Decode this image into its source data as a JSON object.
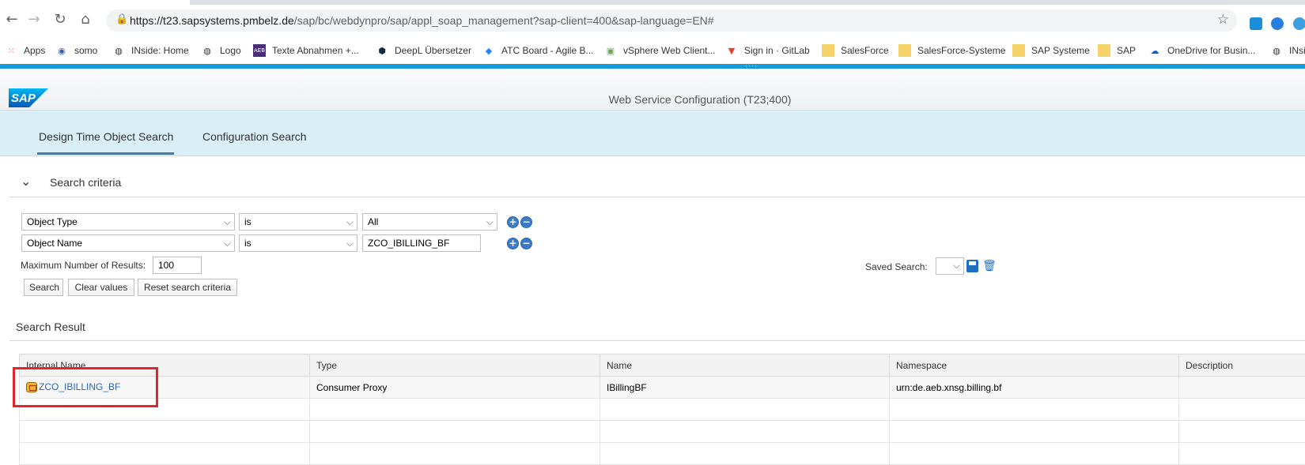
{
  "browser": {
    "url_host": "https://t23.sapsystems.pmbelz.de",
    "url_path": "/sap/bc/webdynpro/sap/appl_soap_management?sap-client=400&sap-language=EN#",
    "bookmarks": [
      {
        "label": "Apps",
        "icon": "apps-grid-icon"
      },
      {
        "label": "somo",
        "icon": "somo-icon"
      },
      {
        "label": "INside: Home",
        "icon": "globe-icon"
      },
      {
        "label": "Logo",
        "icon": "globe-icon"
      },
      {
        "label": "Texte Abnahmen +...",
        "icon": "aeb-icon"
      },
      {
        "label": "DeepL Übersetzer",
        "icon": "deepl-icon"
      },
      {
        "label": "ATC Board - Agile B...",
        "icon": "diamond-icon"
      },
      {
        "label": "vSphere Web Client...",
        "icon": "vsphere-icon"
      },
      {
        "label": "Sign in · GitLab",
        "icon": "gitlab-icon"
      },
      {
        "label": "SalesForce",
        "icon": "folder-icon"
      },
      {
        "label": "SalesForce-Systeme",
        "icon": "folder-icon"
      },
      {
        "label": "SAP Systeme",
        "icon": "folder-icon"
      },
      {
        "label": "SAP",
        "icon": "folder-icon"
      },
      {
        "label": "OneDrive for Busin...",
        "icon": "onedrive-icon"
      },
      {
        "label": "INsi",
        "icon": "globe-icon"
      }
    ]
  },
  "shell": {
    "title": "Web Service Configuration (T23;400)"
  },
  "tabs": [
    {
      "label": "Design Time Object Search",
      "active": true
    },
    {
      "label": "Configuration Search",
      "active": false
    }
  ],
  "criteria": {
    "title": "Search criteria",
    "rows": [
      {
        "field": "Object Type",
        "operator": "is",
        "value": "All"
      },
      {
        "field": "Object Name",
        "operator": "is",
        "value": "ZCO_IBILLING_BF"
      }
    ],
    "max_results_label": "Maximum Number of Results:",
    "max_results_value": "100",
    "saved_search_label": "Saved Search:",
    "buttons": {
      "search": "Search",
      "clear": "Clear values",
      "reset": "Reset search criteria"
    }
  },
  "result": {
    "title": "Search Result",
    "columns": [
      "Internal Name",
      "Type",
      "Name",
      "Namespace",
      "Description"
    ],
    "rows": [
      {
        "internal_name": "ZCO_IBILLING_BF",
        "type": "Consumer Proxy",
        "name": "IBillingBF",
        "namespace": "urn:de.aeb.xnsg.billing.bf",
        "description": ""
      }
    ]
  },
  "colors": {
    "accent_bar": "#1a9ad6",
    "tab_band": "#d9eef5",
    "link": "#2a66b5",
    "highlight": "#e0262a"
  }
}
